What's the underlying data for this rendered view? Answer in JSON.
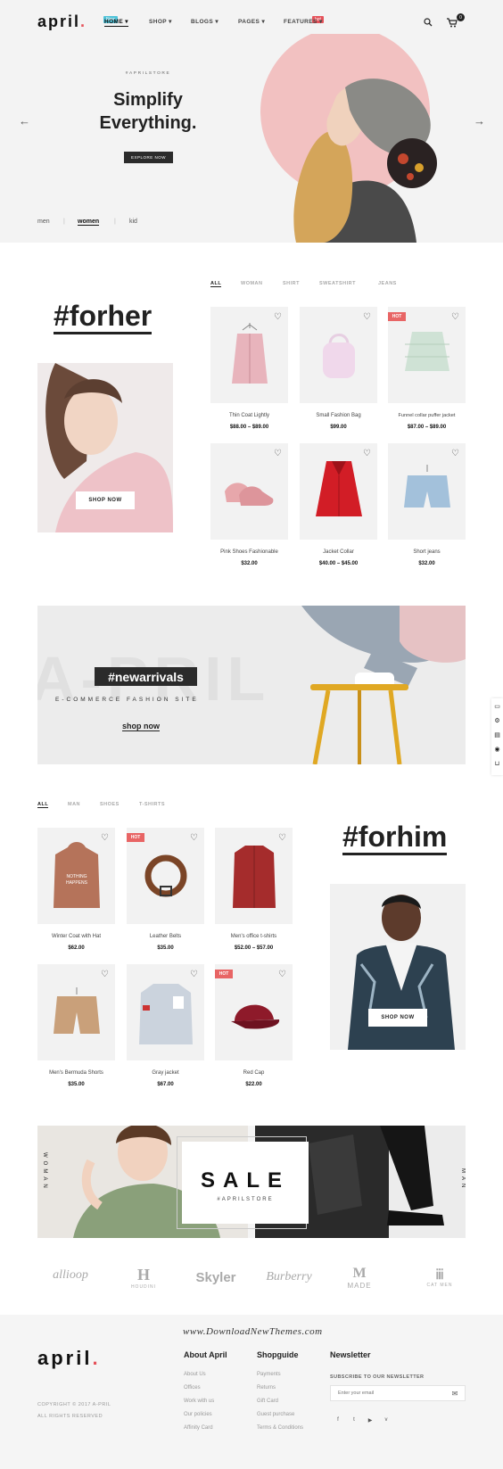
{
  "header": {
    "logo": "april",
    "logo_dot": ".",
    "nav": [
      {
        "label": "HOME ▾",
        "badge": "New",
        "badge_color": "#4fc3d9"
      },
      {
        "label": "SHOP ▾"
      },
      {
        "label": "BLOGS ▾"
      },
      {
        "label": "PAGES ▾"
      },
      {
        "label": "FEATURES ▾",
        "badge": "hot",
        "badge_color": "#e5525a"
      }
    ],
    "cart_count": "0",
    "icons": [
      "search-icon",
      "cart-icon"
    ]
  },
  "hero": {
    "kicker": "#APRILSTORE",
    "title_line1": "Simplify",
    "title_line2": "Everything.",
    "button": "EXPLORE NOW",
    "categories": [
      "men",
      "women",
      "kid"
    ],
    "accent_color": "#f2c1c1"
  },
  "forher": {
    "heading": "#forher",
    "shop_now": "SHOP NOW",
    "tabs": [
      "ALL",
      "WOMAN",
      "SHIRT",
      "SWEATSHIRT",
      "JEANS"
    ],
    "products": [
      {
        "name": "Thin Coat Lightly",
        "price": "$88.00 – $89.00"
      },
      {
        "name": "Small Fashion Bag",
        "price": "$99.00"
      },
      {
        "name": "Funnel collar puffer jacket",
        "price": "$87.00 – $89.00",
        "badge": "HOT"
      },
      {
        "name": "Pink Shoes Fashionable",
        "price": "$32.00"
      },
      {
        "name": "Jacket Collar",
        "price": "$40.00 – $45.00"
      },
      {
        "name": "Short jeans",
        "price": "$32.00"
      }
    ]
  },
  "banner": {
    "watermark": "A-PRIL",
    "heading": "#newarrivals",
    "subtitle": "E-COMMERCE FASHION SITE",
    "link": "shop now"
  },
  "forhim": {
    "heading": "#forhim",
    "shop_now": "SHOP NOW",
    "tabs": [
      "ALL",
      "MAN",
      "SHOES",
      "T-SHIRTS"
    ],
    "products": [
      {
        "name": "Winter Coat with Hat",
        "price": "$62.00"
      },
      {
        "name": "Leather Belts",
        "price": "$35.00",
        "badge": "HOT"
      },
      {
        "name": "Men's office t-shirts",
        "price": "$52.00 – $57.00"
      },
      {
        "name": "Men's Bermuda Shorts",
        "price": "$35.00"
      },
      {
        "name": "Gray jacket",
        "price": "$67.00"
      },
      {
        "name": "Red Cap",
        "price": "$22.00",
        "badge": "HOT"
      }
    ]
  },
  "sale": {
    "title": "SALE",
    "subtitle": "#APRILSTORE",
    "left_side": "WOMAN",
    "right_side": "MAN"
  },
  "brands": [
    "allioop",
    "HOUDINI",
    "Skyler",
    "Burberry",
    "MADE",
    "CAT MEN"
  ],
  "watermark_url": "www.DownloadNewThemes.com",
  "footer": {
    "logo": "april",
    "copyright": "COPYRIGHT © 2017 A-PRIL",
    "rights": "ALL RIGHTS RESERVED",
    "about_title": "About April",
    "about_links": [
      "About Us",
      "Offices",
      "Work with us",
      "Our policies",
      "Affinity Card"
    ],
    "guide_title": "Shopguide",
    "guide_links": [
      "Payments",
      "Returns",
      "Gift Card",
      "Guest purchase",
      "Terms & Conditions"
    ],
    "newsletter_title": "Newsletter",
    "newsletter_label": "SUBSCRIBE TO OUR NEWSLETTER",
    "email_placeholder": "Enter your email",
    "social": [
      "f",
      "t",
      "▶",
      "v"
    ]
  }
}
